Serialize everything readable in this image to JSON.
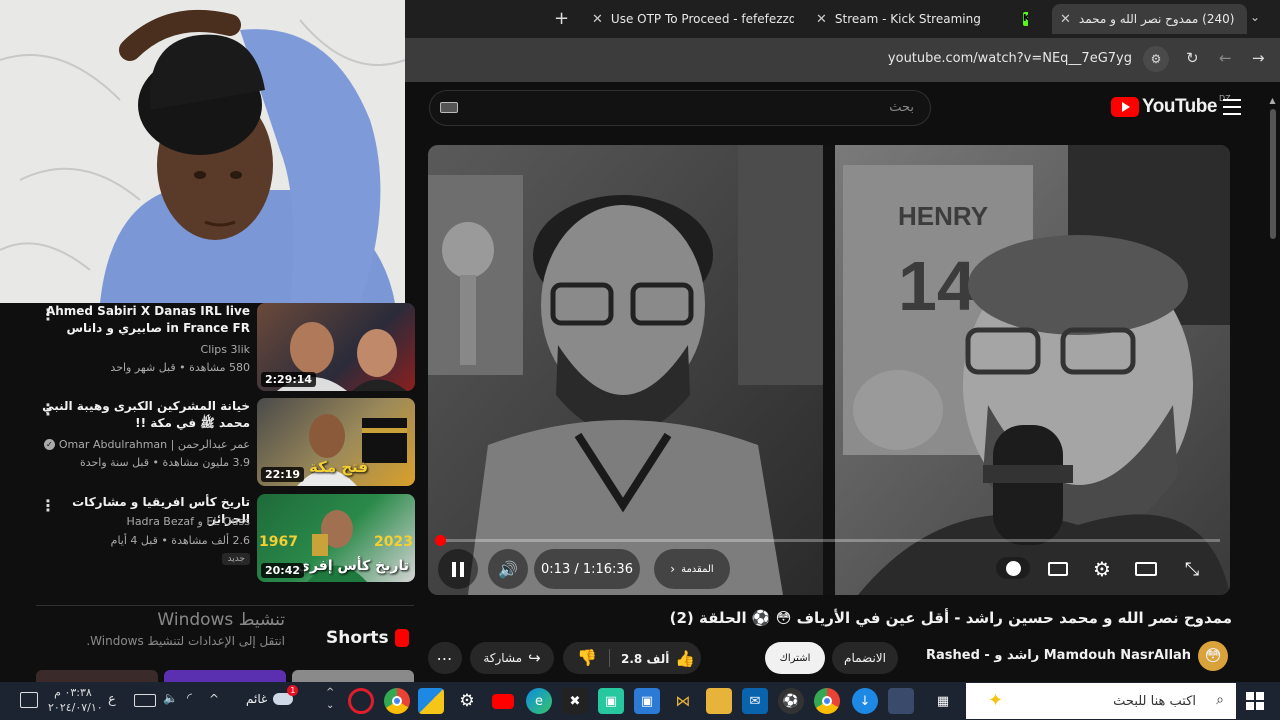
{
  "browser": {
    "tabs": [
      {
        "title": "Use OTP To Proceed - fefefezzd",
        "icon": "gmail-icon"
      },
      {
        "title": "Stream - Kick Streaming",
        "icon": "kick-icon"
      },
      {
        "title": "(240) ممدوح نصر الله و محمد",
        "icon": "youtube-icon"
      }
    ],
    "new_tab": "+",
    "url": "youtube.com/watch?v=NEq__7eG7yg"
  },
  "youtube": {
    "logo_text": "YouTube",
    "region": "DZ",
    "search_placeholder": "بحث",
    "player": {
      "time": "0:13 / 1:16:36",
      "chapter_label": "المقدمة",
      "progress_fraction": 0.003,
      "jersey_text": "HENRY",
      "jersey_number": "14"
    },
    "video": {
      "title": "ممدوح نصر الله و محمد حسين راشد - أقل عين في الأرياف 😳 ⚽ الحلقة (2)",
      "channel": "Rashed - راشد و Mamdouh NasrAllah",
      "join_label": "الانضمام",
      "subscribe_label": "اشتراك",
      "likes": "2.8 ألف",
      "share_label": "مشاركة"
    },
    "sidebar": [
      {
        "title": "Ahmed Sabiri X Danas IRL live in France FR صابيري و داناس لحظة ...",
        "channel": "Clips 3lik",
        "meta": "580 مشاهدة • قبل شهر واحد",
        "duration": "2:29:14"
      },
      {
        "title": "خيانة المشركين الكبرى وهيبة النبي محمد ﷺ في مكة !!",
        "channel": "عمر عبدالرحمن | Omar Abdulrahman",
        "meta": "3.9 مليون مشاهدة • قبل سنة واحدة",
        "duration": "22:19",
        "thumb_text": "فتح مكة"
      },
      {
        "title": "تاريخ كأس افريقيا و مشاركات الجزائر",
        "channel": "EL Ouss و Hadra Bezaf",
        "meta": "2.6 ألف مشاهدة • قبل 4 أيام",
        "badge": "جديد",
        "duration": "20:42",
        "thumb_text": "تاريخ كأس إفري",
        "years": [
          "1967",
          "2023"
        ]
      }
    ],
    "shorts_label": "Shorts",
    "activation": {
      "title": "تنشيط Windows",
      "subtitle": "انتقل إلى الإعدادات لتنشيط Windows."
    }
  },
  "taskbar": {
    "search_placeholder": "اكتب هنا للبحث",
    "weather": "غائم",
    "lang": "ع",
    "time": "٠٣:٣٨ م",
    "date": "٢٠٢٤/٠٧/١٠",
    "notification_count": "1"
  }
}
